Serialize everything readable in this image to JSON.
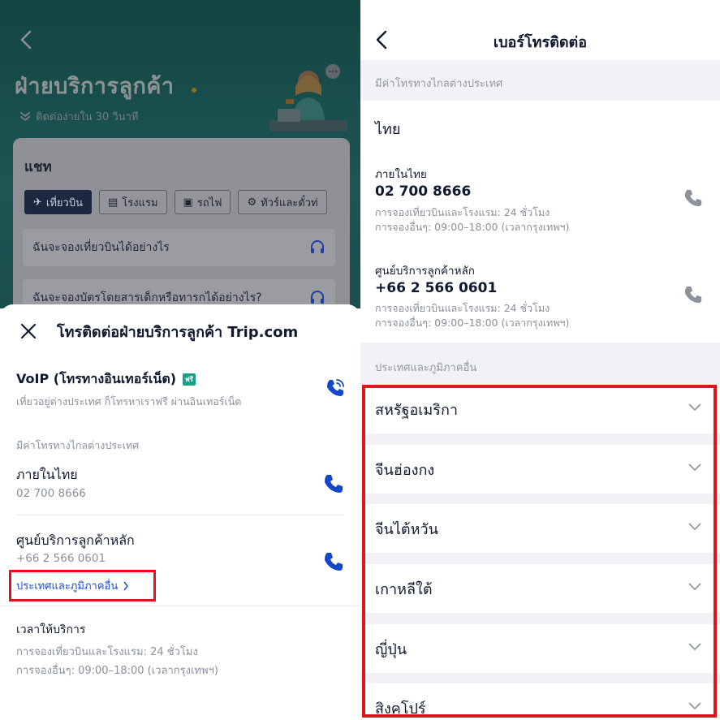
{
  "left": {
    "header": {
      "back_icon": "chevron-left-icon",
      "title": "ฝ่ายบริการลูกค้า",
      "subtitle": "ติดต่อง่ายใน 30 วินาที",
      "subtitle_icon": "double-chevron-down-icon"
    },
    "chat": {
      "title": "แชท",
      "chips": [
        {
          "label": "เที่ยวบิน",
          "icon": "plane-icon",
          "active": true
        },
        {
          "label": "โรงแรม",
          "icon": "hotel-icon",
          "active": false
        },
        {
          "label": "รถไฟ",
          "icon": "train-icon",
          "active": false
        },
        {
          "label": "ทัวร์และตั๋วท่",
          "icon": "ticket-icon",
          "active": false
        }
      ],
      "questions": [
        "ฉันจะจองเที่ยวบินได้อย่างไร",
        "ฉันจะจองบัตรโดยสารเด็กหรือทารกได้อย่างไร?"
      ]
    },
    "sheet": {
      "title": "โทรติดต่อฝ่ายบริการลูกค้า Trip.com",
      "voip": {
        "title": "VoIP (โทรทางอินเทอร์เน็ต)",
        "badge": "ฟรี",
        "description": "เที่ยวอยู่ต่างประเทศ ก็โทรหาเราฟรี ผ่านอินเทอร์เน็ต"
      },
      "section_label": "มีค่าโทรทางไกลต่างประเทศ",
      "rows": [
        {
          "title": "ภายในไทย",
          "number": "02 700 8666"
        },
        {
          "title": "ศูนย์บริการลูกค้าหลัก",
          "number": "+66 2 566 0601"
        }
      ],
      "more_link": "ประเทศและภูมิภาคอื่น",
      "hours": {
        "title": "เวลาให้บริการ",
        "lines": [
          "การจองเที่ยวบินและโรงแรม: 24 ชั่วโมง",
          "การจองอื่นๆ: 09:00–18:00 (เวลากรุงเทพฯ)"
        ]
      }
    }
  },
  "right": {
    "title": "เบอร์โทรติดต่อ",
    "section_label": "มีค่าโทรทางไกลต่างประเทศ",
    "country": "ไทย",
    "entries": [
      {
        "label": "ภายในไทย",
        "number": "02 700 8666",
        "line1": "การจองเที่ยวบินและโรงแรม: 24 ชั่วโมง",
        "line2": "การจองอื่นๆ: 09:00–18:00 (เวลากรุงเทพฯ)"
      },
      {
        "label": "ศูนย์บริการลูกค้าหลัก",
        "number": "+66 2 566 0601",
        "line1": "การจองเที่ยวบินและโรงแรม: 24 ชั่วโมง",
        "line2": "การจองอื่นๆ: 09:00–18:00 (เวลากรุงเทพฯ)"
      }
    ],
    "other_label": "ประเทศและภูมิภาคอื่น",
    "countries": [
      "สหรัฐอเมริกา",
      "จีนฮ่องกง",
      "จีนไต้หวัน",
      "เกาหลีใต้",
      "ญี่ปุ่น",
      "สิงคโปร์"
    ]
  },
  "colors": {
    "accent_blue": "#1447c8",
    "link_blue": "#1b4fd6",
    "highlight_red": "#e0141d",
    "teal_header": "#2f8a86",
    "free_badge": "#12a38a"
  }
}
